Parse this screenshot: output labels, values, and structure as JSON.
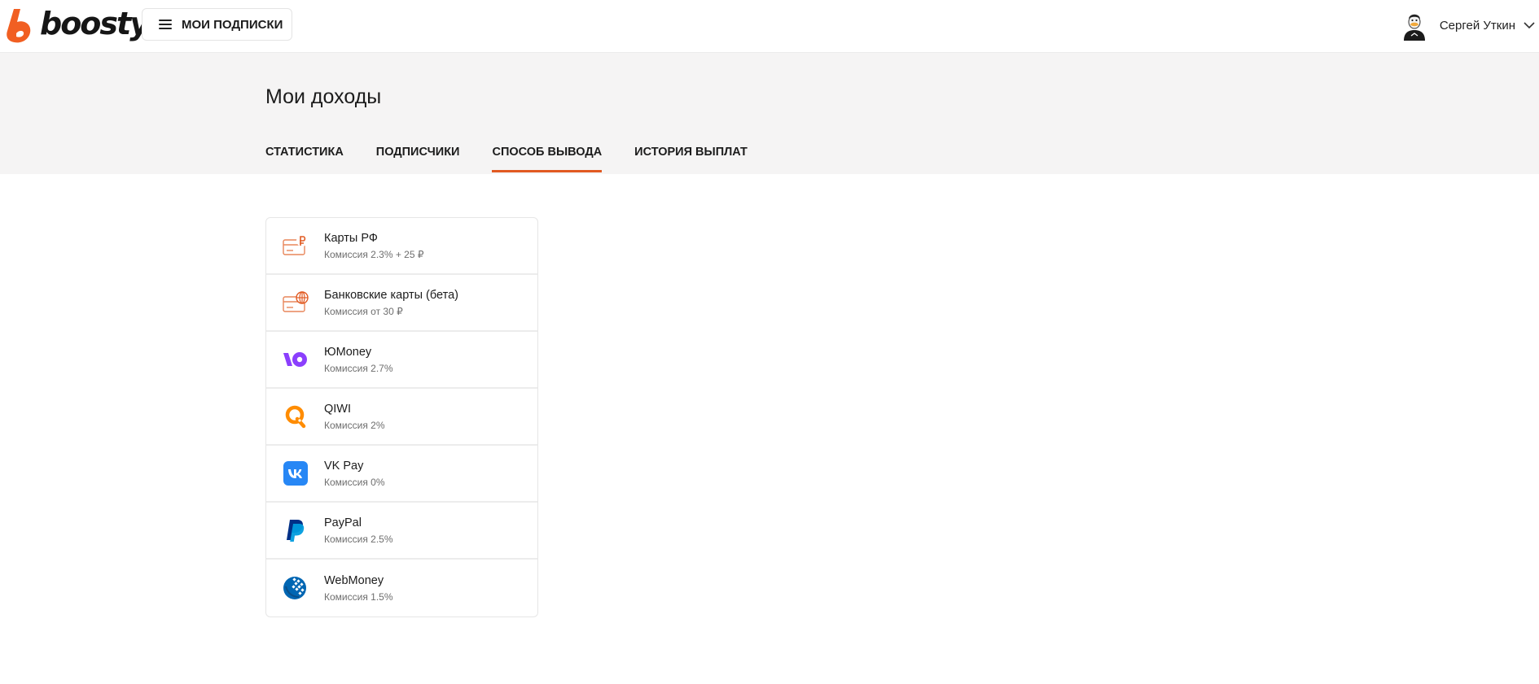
{
  "header": {
    "logo_text": "boosty",
    "menu_label": "МОИ ПОДПИСКИ",
    "user_name": "Сергей Уткин"
  },
  "page": {
    "title": "Мои доходы",
    "tabs": [
      {
        "label": "СТАТИСТИКА",
        "active": false
      },
      {
        "label": "ПОДПИСЧИКИ",
        "active": false
      },
      {
        "label": "СПОСОБ ВЫВОДА",
        "active": true
      },
      {
        "label": "ИСТОРИЯ ВЫПЛАТ",
        "active": false
      }
    ]
  },
  "methods": [
    {
      "name": "Карты РФ",
      "fee": "Комиссия 2.3% + 25 ₽",
      "icon": "card-ruble-icon"
    },
    {
      "name": "Банковские карты (бета)",
      "fee": "Комиссия от 30 ₽",
      "icon": "card-globe-icon"
    },
    {
      "name": "ЮMoney",
      "fee": "Комиссия 2.7%",
      "icon": "yoomoney-icon"
    },
    {
      "name": "QIWI",
      "fee": "Комиссия 2%",
      "icon": "qiwi-icon"
    },
    {
      "name": "VK Pay",
      "fee": "Комиссия 0%",
      "icon": "vk-icon"
    },
    {
      "name": "PayPal",
      "fee": "Комиссия 2.5%",
      "icon": "paypal-icon"
    },
    {
      "name": "WebMoney",
      "fee": "Комиссия 1.5%",
      "icon": "webmoney-icon"
    }
  ],
  "colors": {
    "accent": "#e15a22",
    "band_bg": "#f5f4f4",
    "yoomoney": "#8b3ffd",
    "qiwi": "#ff8c00",
    "vk": "#2787f5",
    "paypal_dark": "#003087",
    "paypal_light": "#009cde",
    "webmoney": "#0066b3"
  }
}
